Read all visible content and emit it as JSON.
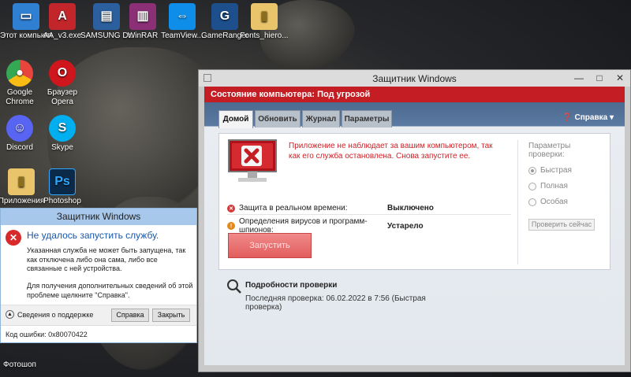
{
  "desktop": {
    "icons": [
      {
        "label": "Этот компьютер...",
        "icon": "computer-icon",
        "color": "#2f7fd3"
      },
      {
        "label": "AA_v3.exe",
        "icon": "aa-icon",
        "color": "#c2262b"
      },
      {
        "label": "SAMSUNG Dr.Printer",
        "icon": "printer-icon",
        "color": "#2b5f9e"
      },
      {
        "label": "WinRAR",
        "icon": "winrar-icon",
        "color": "#8b2f76"
      },
      {
        "label": "TeamView...",
        "icon": "teamviewer-icon",
        "color": "#0e8ee9"
      },
      {
        "label": "GameRanger",
        "icon": "gameranger-icon",
        "color": "#1d4f8c"
      },
      {
        "label": "Fonts_hiero...",
        "icon": "folder-icon",
        "color": "#e9c46a"
      },
      {
        "label": "Google Chrome",
        "icon": "chrome-icon",
        "color": "#e8453c"
      },
      {
        "label": "Браузер Opera",
        "icon": "opera-icon",
        "color": "#d0161d"
      },
      {
        "label": "Discord",
        "icon": "discord-icon",
        "color": "#5865f2"
      },
      {
        "label": "Skype",
        "icon": "skype-icon",
        "color": "#00aff0"
      },
      {
        "label": "Приложения",
        "icon": "folder-icon",
        "color": "#e9c46a"
      },
      {
        "label": "Photoshop",
        "icon": "photoshop-icon",
        "color": "#0b2a4a"
      },
      {
        "label": "Фотошоп",
        "icon": "folder-icon",
        "color": "#e9c46a"
      }
    ]
  },
  "defender": {
    "title": "Защитник Windows",
    "status": "Состояние компьютера: Под угрозой",
    "tabs": [
      "Домой",
      "Обновить",
      "Журнал",
      "Параметры"
    ],
    "help": "Справка",
    "message": "Приложение не наблюдает за вашим компьютером, так как его служба остановлена. Снова запустите ее.",
    "realtime_label": "Защита в реальном времени:",
    "realtime_value": "Выключено",
    "definitions_label": "Определения вирусов и программ-шпионов:",
    "definitions_value": "Устарело",
    "start_button": "Запустить",
    "scan_options_label": "Параметры проверки:",
    "scan_options": [
      "Быстрая",
      "Полная",
      "Особая"
    ],
    "scan_now": "Проверить сейчас",
    "details_title": "Подробности проверки",
    "last_scan": "Последняя проверка: 06.02.2022 в 7:56 (Быстрая проверка)",
    "colors": {
      "danger": "#c41e24",
      "accent": "#4d6a8f"
    }
  },
  "error_dialog": {
    "title": "Защитник Windows",
    "heading": "Не удалось запустить службу.",
    "text1": "Указанная служба не может быть запущена, так как отключена либо она сама, либо все связанные с ней устройства.",
    "text2": "Для получения дополнительных сведений об этой проблеме щелкните \"Справка\".",
    "support_details": "Сведения о поддержке",
    "help_button": "Справка",
    "close_button": "Закрыть",
    "error_code": "Код ошибки: 0x80070422"
  }
}
